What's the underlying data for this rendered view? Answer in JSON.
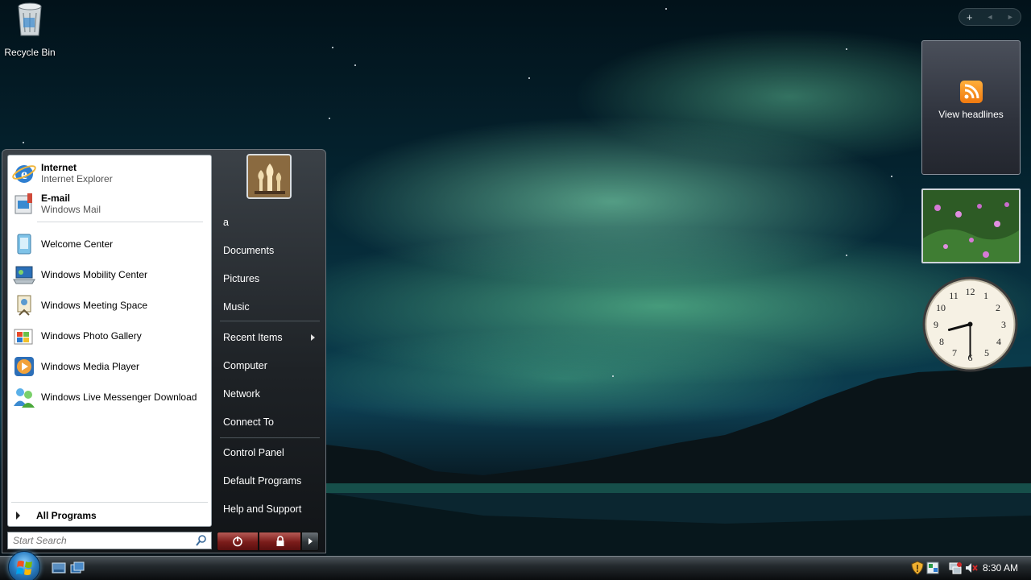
{
  "desktop": {
    "recycle_bin_label": "Recycle Bin"
  },
  "gadgets": {
    "sidebar_controls": {
      "add": "+",
      "prev": "◄",
      "next": "►"
    },
    "feed_headlines_label": "View headlines",
    "clock": {
      "hour": 8,
      "minute": 30
    }
  },
  "start_menu": {
    "pinned": [
      {
        "title": "Internet",
        "subtitle": "Internet Explorer",
        "icon": "internet-explorer-icon"
      },
      {
        "title": "E-mail",
        "subtitle": "Windows Mail",
        "icon": "windows-mail-icon"
      }
    ],
    "recent": [
      {
        "label": "Welcome Center",
        "icon": "welcome-center-icon"
      },
      {
        "label": "Windows Mobility Center",
        "icon": "mobility-center-icon"
      },
      {
        "label": "Windows Meeting Space",
        "icon": "meeting-space-icon"
      },
      {
        "label": "Windows Photo Gallery",
        "icon": "photo-gallery-icon"
      },
      {
        "label": "Windows Media Player",
        "icon": "media-player-icon"
      },
      {
        "label": "Windows Live Messenger Download",
        "icon": "messenger-icon"
      }
    ],
    "all_programs": "All Programs",
    "search_placeholder": "Start Search",
    "right": {
      "user": "a",
      "documents": "Documents",
      "pictures": "Pictures",
      "music": "Music",
      "recent_items": "Recent Items",
      "computer": "Computer",
      "network": "Network",
      "connect_to": "Connect To",
      "control_panel": "Control Panel",
      "default_programs": "Default Programs",
      "help_support": "Help and Support"
    }
  },
  "taskbar": {
    "time": "8:30 AM"
  }
}
